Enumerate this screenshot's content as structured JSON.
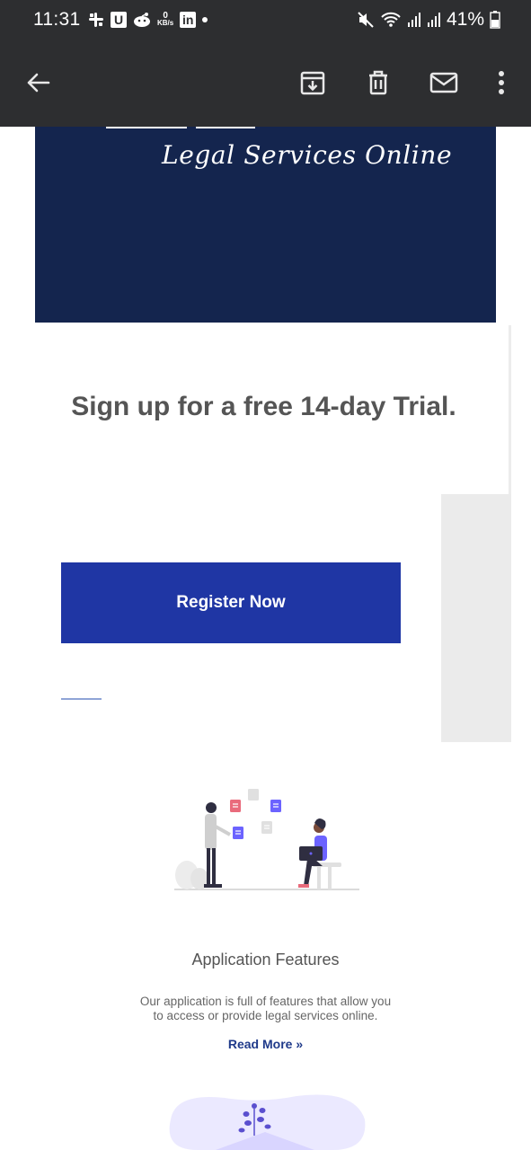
{
  "status_bar": {
    "time": "11:31",
    "kbs_value": "0",
    "kbs_unit": "KB/s",
    "u_badge": "U",
    "in_badge": "in",
    "battery": "41%"
  },
  "app_bar": {
    "icons": [
      "back-arrow-icon",
      "archive-icon",
      "delete-icon",
      "mark-unread-icon",
      "more-vert-icon"
    ]
  },
  "hero": {
    "tagline": "Legal Services Online",
    "background": "#14254e"
  },
  "trial": {
    "heading": "Sign up for a free 14-day Trial."
  },
  "register": {
    "label": "Register Now",
    "color": "#1f36a4"
  },
  "features": {
    "title": "Application Features",
    "description": "Our application is full of features that allow you to access or provide legal services online.",
    "read_more": "Read More »"
  }
}
